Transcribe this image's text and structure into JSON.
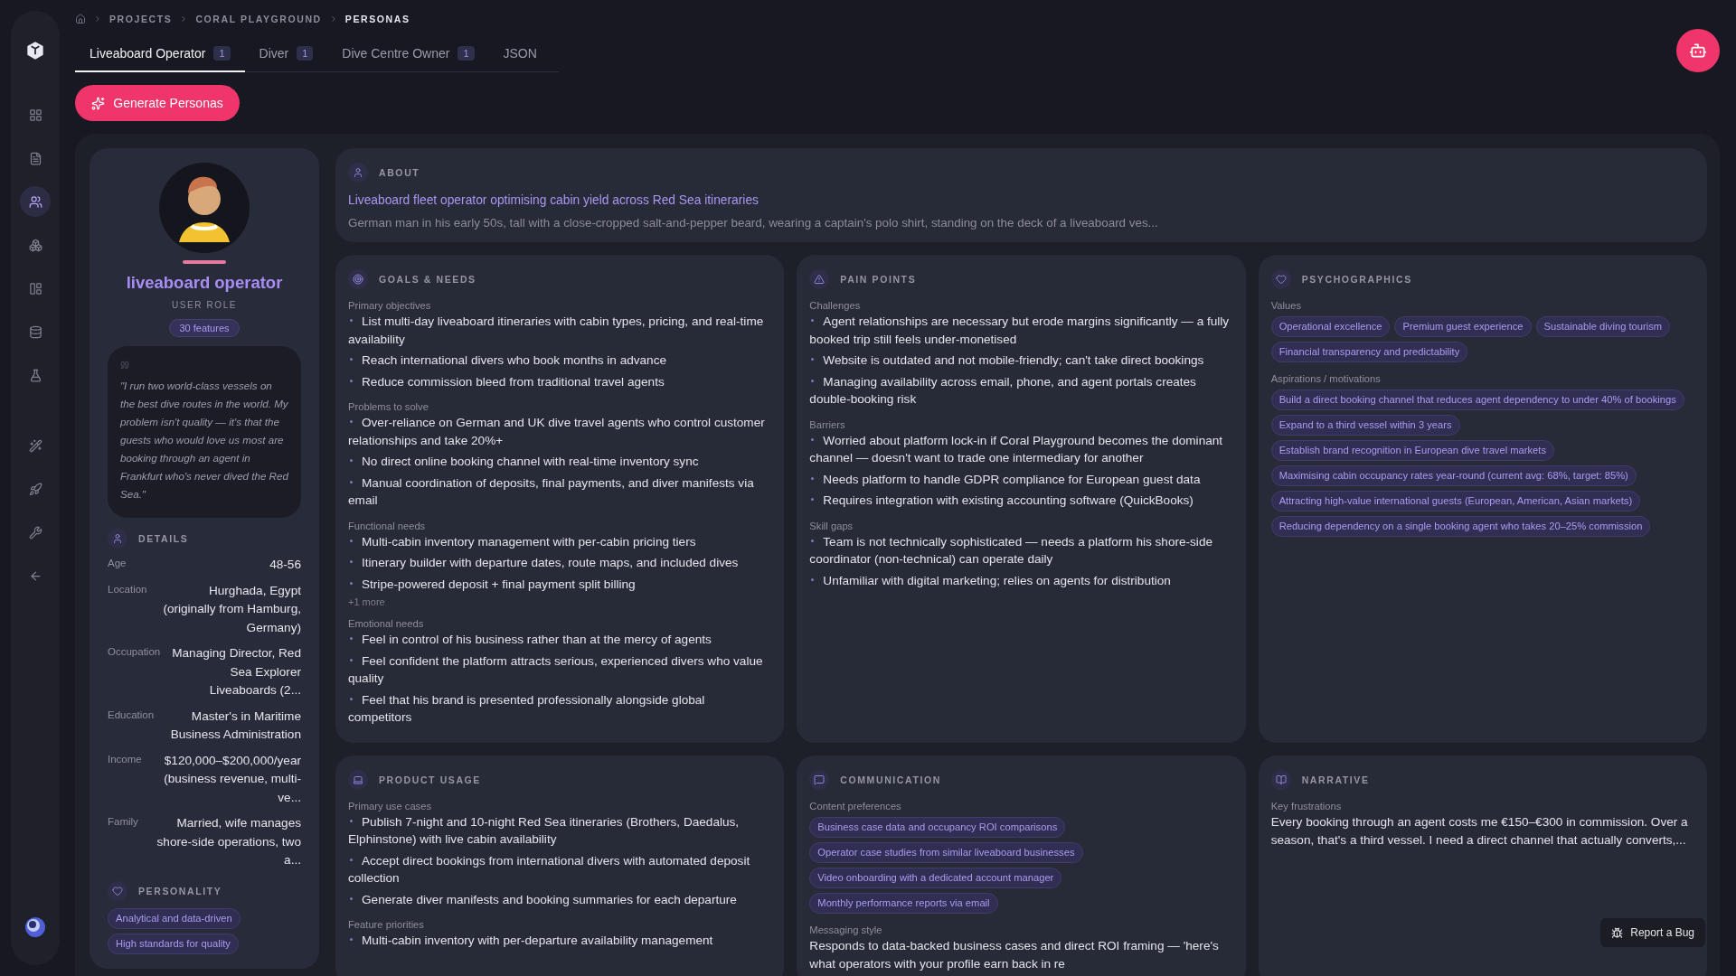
{
  "breadcrumb": [
    {
      "label": "PROJECTS",
      "current": false
    },
    {
      "label": "CORAL PLAYGROUND",
      "current": false
    },
    {
      "label": "PERSONAS",
      "current": true
    }
  ],
  "tabs": [
    {
      "label": "Liveaboard Operator",
      "count": "1",
      "selected": true
    },
    {
      "label": "Diver",
      "count": "1",
      "selected": false
    },
    {
      "label": "Dive Centre Owner",
      "count": "1",
      "selected": false
    },
    {
      "label": "JSON",
      "selected": false
    }
  ],
  "generate_button": "Generate Personas",
  "profile": {
    "name": "liveaboard operator",
    "role": "USER ROLE",
    "features": "30 features",
    "quote": "\"I run two world-class vessels on the best dive routes in the world. My problem isn't quality — it's that the guests who would love us most are booking through an agent in Frankfurt who's never dived the Red Sea.\"",
    "details_title": "DETAILS",
    "details": [
      {
        "label": "Age",
        "value": "48-56"
      },
      {
        "label": "Location",
        "value": "Hurghada, Egypt (originally from Hamburg, Germany)"
      },
      {
        "label": "Occupation",
        "value": "Managing Director, Red Sea Explorer Liveaboards (2..."
      },
      {
        "label": "Education",
        "value": "Master's in Maritime Business Administration"
      },
      {
        "label": "Income",
        "value": "$120,000–$200,000/year (business revenue, multi-ve..."
      },
      {
        "label": "Family",
        "value": "Married, wife manages shore-side operations, two a..."
      }
    ],
    "personality_title": "PERSONALITY",
    "personality": [
      "Analytical and data-driven",
      "High standards for quality"
    ]
  },
  "about": {
    "title": "ABOUT",
    "headline": "Liveaboard fleet operator optimising cabin yield across Red Sea itineraries",
    "description": "German man in his early 50s, tall with a close-cropped salt-and-pepper beard, wearing a captain's polo shirt, standing on the deck of a liveaboard ves..."
  },
  "goals_needs": {
    "title": "GOALS & NEEDS",
    "groups": [
      {
        "kind": "bullets",
        "label": "Primary objectives",
        "items": [
          "List multi-day liveaboard itineraries with cabin types, pricing, and real-time availability",
          "Reach international divers who book months in advance",
          "Reduce commission bleed from traditional travel agents"
        ]
      },
      {
        "kind": "bullets",
        "label": "Problems to solve",
        "items": [
          "Over-reliance on German and UK dive travel agents who control customer relationships and take 20%+",
          "No direct online booking channel with real-time inventory sync",
          "Manual coordination of deposits, final payments, and diver manifests via email"
        ]
      },
      {
        "kind": "bullets",
        "label": "Functional needs",
        "items": [
          "Multi-cabin inventory management with per-cabin pricing tiers",
          "Itinerary builder with departure dates, route maps, and included dives",
          "Stripe-powered deposit + final payment split billing"
        ],
        "more": "+1 more"
      },
      {
        "kind": "bullets",
        "label": "Emotional needs",
        "items": [
          "Feel in control of his business rather than at the mercy of agents",
          "Feel confident the platform attracts serious, experienced divers who value quality",
          "Feel that his brand is presented professionally alongside global competitors"
        ]
      }
    ]
  },
  "pain_points": {
    "title": "PAIN POINTS",
    "groups": [
      {
        "kind": "bullets",
        "label": "Challenges",
        "items": [
          "Agent relationships are necessary but erode margins significantly — a fully booked trip still feels under-monetised",
          "Website is outdated and not mobile-friendly; can't take direct bookings",
          "Managing availability across email, phone, and agent portals creates double-booking risk"
        ]
      },
      {
        "kind": "bullets",
        "label": "Barriers",
        "items": [
          "Worried about platform lock-in if Coral Playground becomes the dominant channel — doesn't want to trade one intermediary for another",
          "Needs platform to handle GDPR compliance for European guest data",
          "Requires integration with existing accounting software (QuickBooks)"
        ]
      },
      {
        "kind": "bullets",
        "label": "Skill gaps",
        "items": [
          "Team is not technically sophisticated — needs a platform his shore-side coordinator (non-technical) can operate daily",
          "Unfamiliar with digital marketing; relies on agents for distribution"
        ]
      }
    ]
  },
  "psychographics": {
    "title": "PSYCHOGRAPHICS",
    "groups": [
      {
        "kind": "tags",
        "label": "Values",
        "items": [
          "Operational excellence",
          "Premium guest experience",
          "Sustainable diving tourism",
          "Financial transparency and predictability"
        ]
      },
      {
        "kind": "tags",
        "label": "Aspirations / motivations",
        "items": [
          "Build a direct booking channel that reduces agent dependency to under 40% of bookings",
          "Expand to a third vessel within 3 years",
          "Establish brand recognition in European dive travel markets",
          "Maximising cabin occupancy rates year-round (current avg: 68%, target: 85%)",
          "Attracting high-value international guests (European, American, Asian markets)",
          "Reducing dependency on a single booking agent who takes 20–25% commission"
        ]
      }
    ]
  },
  "product_usage": {
    "title": "PRODUCT USAGE",
    "groups": [
      {
        "kind": "bullets",
        "label": "Primary use cases",
        "items": [
          "Publish 7-night and 10-night Red Sea itineraries (Brothers, Daedalus, Elphinstone) with live cabin availability",
          "Accept direct bookings from international divers with automated deposit collection",
          "Generate diver manifests and booking summaries for each departure"
        ]
      },
      {
        "kind": "bullets",
        "label": "Feature priorities",
        "items": [
          "Multi-cabin inventory with per-departure availability management"
        ]
      }
    ]
  },
  "communication": {
    "title": "COMMUNICATION",
    "groups": [
      {
        "kind": "tags",
        "label": "Content preferences",
        "items": [
          "Business case data and occupancy ROI comparisons",
          "Operator case studies from similar liveaboard businesses",
          "Video onboarding with a dedicated account manager",
          "Monthly performance reports via email"
        ]
      },
      {
        "kind": "text",
        "label": "Messaging style",
        "text": "Responds to data-backed business cases and direct ROI framing — 'here's what operators with your profile earn back in re"
      }
    ]
  },
  "narrative": {
    "title": "NARRATIVE",
    "groups": [
      {
        "kind": "text",
        "label": "Key frustrations",
        "text": "Every booking through an agent costs me €150–€300 in commission. Over a season, that's a third vessel. I need a direct channel that actually converts,..."
      }
    ]
  },
  "report_button": "Report a Bug"
}
